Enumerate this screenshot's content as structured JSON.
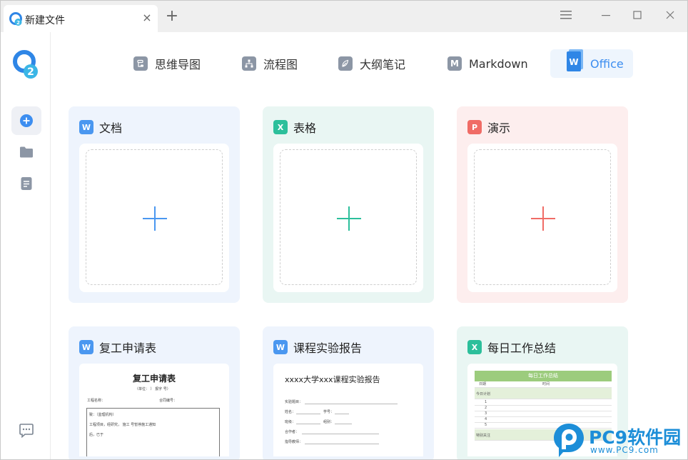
{
  "window": {
    "tab_title": "新建文件",
    "tab_close": "×",
    "new_tab": "+"
  },
  "modes": [
    {
      "label": "思维导图",
      "icon": "mindmap-icon"
    },
    {
      "label": "流程图",
      "icon": "flowchart-icon"
    },
    {
      "label": "大纲笔记",
      "icon": "outline-note-icon"
    },
    {
      "label": "Markdown",
      "icon": "markdown-icon",
      "glyph": "M"
    },
    {
      "label": "Office",
      "icon": "office-word-icon",
      "active": true
    }
  ],
  "cards": [
    {
      "badge": "W",
      "title": "文档",
      "color": "#4a97f0"
    },
    {
      "badge": "X",
      "title": "表格",
      "color": "#2cbf9b"
    },
    {
      "badge": "P",
      "title": "演示",
      "color": "#f06c66"
    }
  ],
  "templates": [
    {
      "badge": "W",
      "title": "复工申请表",
      "doc_heading": "复工申请表",
      "lines": [
        "（单位：        ）    报字    号）",
        "工程名称：",
        "合同编号：",
        "致：（监理机构）",
        "工程项目，经研究，    施工    号暂停施工通知",
        "后，已于"
      ]
    },
    {
      "badge": "W",
      "title": "课程实验报告",
      "doc_heading": "xxxx大学xxx课程实验报告",
      "lines": [
        "实验题目：",
        "姓名：",
        "学号：",
        "班级：",
        "组别：",
        "合作者：",
        "指导教师："
      ]
    },
    {
      "badge": "X",
      "title": "每日工作总结",
      "sheet_heading": "每日工作总结",
      "col_date": "日期",
      "col_time": "时间",
      "section_plan": "今日计划",
      "rows": [
        "1",
        "2",
        "3",
        "4",
        "5"
      ],
      "section_special": "特别关注"
    }
  ],
  "watermark": {
    "brand": "PC9软件园",
    "url": "www.PC9.com"
  }
}
